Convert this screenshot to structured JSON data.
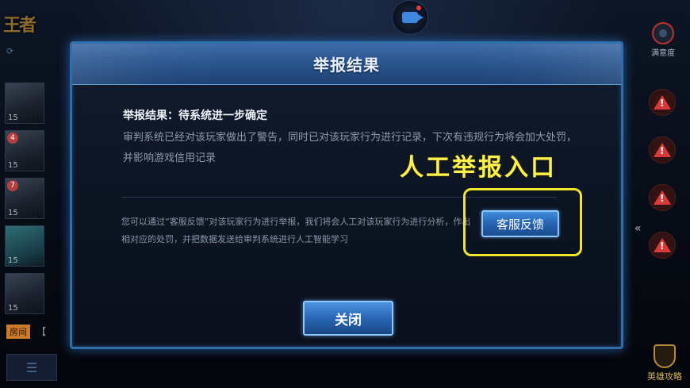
{
  "dialog": {
    "title": "举报结果",
    "result_head": "举报结果：待系统进一步确定",
    "result_body": "审判系统已经对该玩家做出了警告，同时已对该玩家行为进行记录，下次有违规行为将会加大处罚，并影响游戏信用记录",
    "info_text": "您可以通过“客服反馈”对该玩家行为进行举报，我们将会人工对该玩家行为进行分析，作出相对应的处罚，并把数据发送给审判系统进行人工智能学习",
    "cs_button_label": "客服反馈",
    "close_button_label": "关闭"
  },
  "annotation": {
    "text": "人工举报入口",
    "color": "#f2e52a"
  },
  "background": {
    "right_top_label": "满意度",
    "room_tag": "房间",
    "strategy_label": "英雄攻略",
    "heroes": [
      {
        "level": "15",
        "fav": ""
      },
      {
        "level": "15",
        "fav": "4"
      },
      {
        "level": "15",
        "fav": "7"
      },
      {
        "level": "15",
        "fav": ""
      },
      {
        "level": "15",
        "fav": ""
      }
    ]
  },
  "icons": {
    "record": "video-camera-icon",
    "warning": "warning-triangle-icon",
    "chat": "menu-list-icon"
  }
}
